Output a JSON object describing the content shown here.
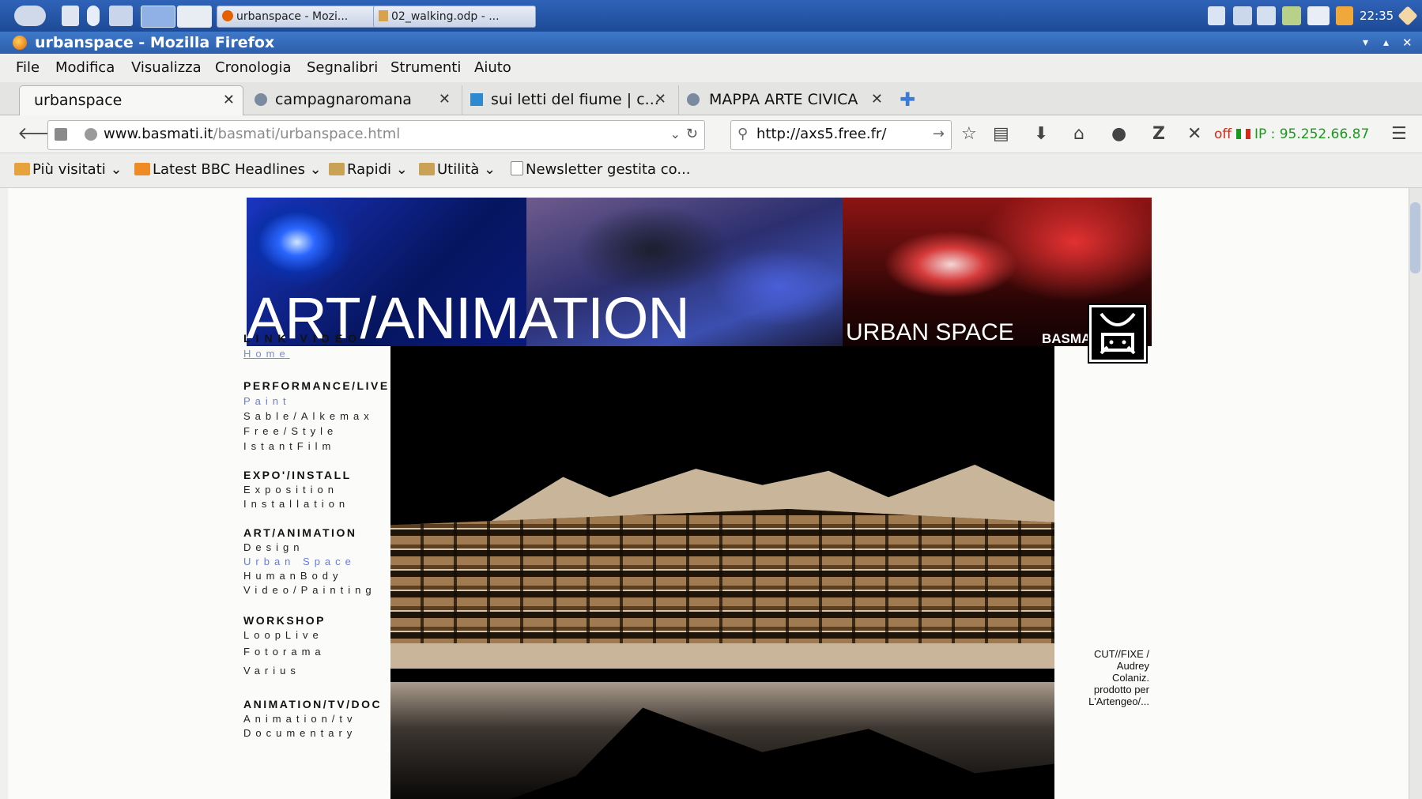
{
  "taskbar": {
    "tasks": [
      {
        "label": "urbanspace - Mozi..."
      },
      {
        "label": "02_walking.odp - ..."
      }
    ],
    "clock": "22:35"
  },
  "window": {
    "title": "urbanspace - Mozilla Firefox"
  },
  "menu": {
    "items": [
      "File",
      "Modifica",
      "Visualizza",
      "Cronologia",
      "Segnalibri",
      "Strumenti",
      "Aiuto"
    ]
  },
  "tabs": [
    {
      "label": "urbanspace"
    },
    {
      "label": "campagnaromana"
    },
    {
      "label": "sui letti del fiume | c..."
    },
    {
      "label": "MAPPA ARTE CIVICA"
    }
  ],
  "nav": {
    "url_domain": "www.basmati.it",
    "url_path": "/basmati/urbanspace.html",
    "search_value": "http://axs5.free.fr/",
    "status_off": "off",
    "ip": "IP : 95.252.66.87"
  },
  "bookmarks": [
    {
      "label": "Più visitati"
    },
    {
      "label": "Latest BBC Headlines"
    },
    {
      "label": "Rapidi"
    },
    {
      "label": "Utilità"
    },
    {
      "label": "Newsletter gestita co..."
    }
  ],
  "site": {
    "banner_title": "ART/ANIMATION",
    "banner_sub": "URBAN SPACE",
    "banner_brand": "BASMATI FILM",
    "sidenav": {
      "link_video": "LINK VIDEO",
      "home": "Home",
      "sections": [
        {
          "title": "PERFORMANCE/LIVE",
          "links": [
            "Paint",
            "Sable/Alkemax",
            "Free/Style",
            "IstantFilm"
          ]
        },
        {
          "title": "EXPO'/INSTALL",
          "links": [
            "Exposition",
            "Installation"
          ]
        },
        {
          "title": "ART/ANIMATION",
          "links": [
            "Design",
            "Urban Space",
            "HumanBody",
            "Video/Painting"
          ]
        },
        {
          "title": "WORKSHOP",
          "links": [
            "LoopLive",
            "Fotorama",
            "Varius"
          ]
        },
        {
          "title": "ANIMATION/TV/DOC",
          "links": [
            "Animation/tv",
            "Documentary"
          ]
        }
      ]
    },
    "credit": {
      "line1": "CUT//FIXE /",
      "line2": "Audrey",
      "line3": "Colaniz.",
      "line4": "prodotto per",
      "line5": "L'Artengeo/..."
    }
  },
  "colors": {
    "taskbar": "#1d4a96",
    "link_active": "#6a7bd6",
    "ip_green": "#1a9a1a",
    "off_red": "#d42a1a"
  }
}
